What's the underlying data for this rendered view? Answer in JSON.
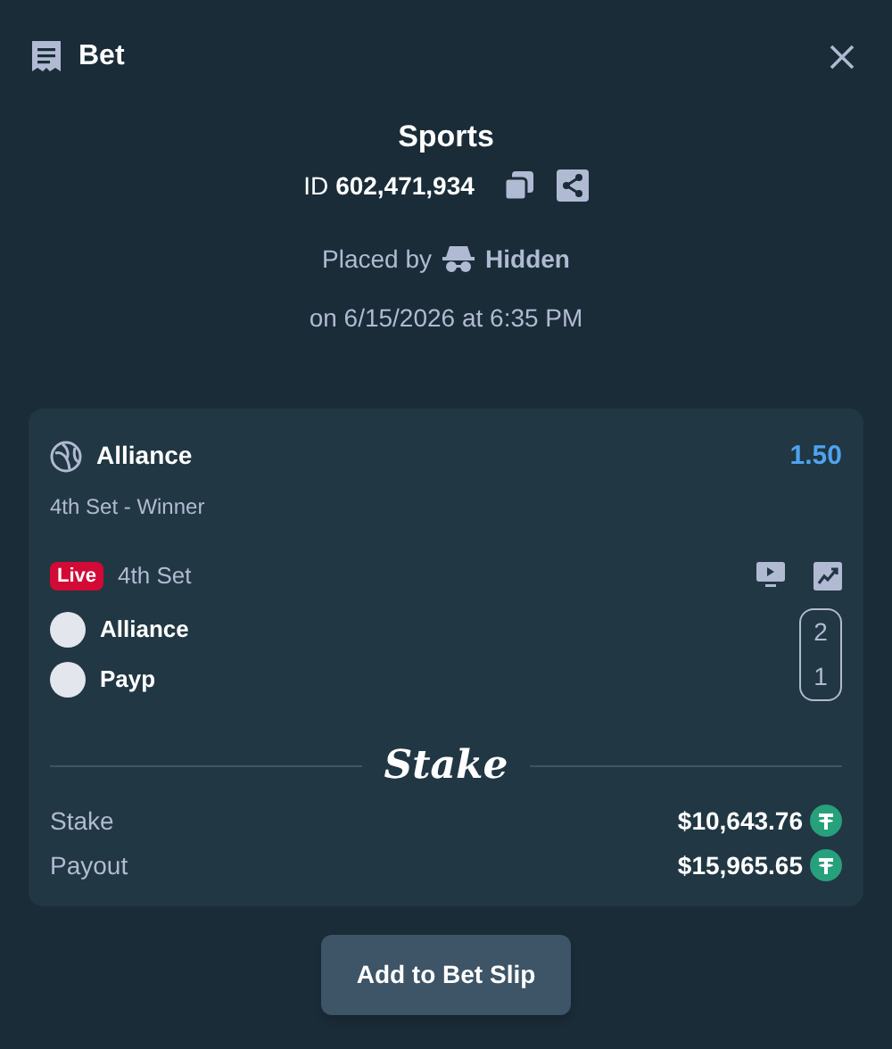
{
  "header": {
    "title": "Bet"
  },
  "summary": {
    "category": "Sports",
    "id_label": "ID",
    "id_value": "602,471,934",
    "placed_by_label": "Placed by",
    "placed_by_user": "Hidden",
    "placed_on": "on 6/15/2026 at 6:35 PM"
  },
  "selection": {
    "team": "Alliance",
    "odds": "1.50",
    "market": "4th Set - Winner",
    "live_badge": "Live",
    "period": "4th Set"
  },
  "scoreboard": [
    {
      "team": "Alliance",
      "score": "2"
    },
    {
      "team": "Payp",
      "score": "1"
    }
  ],
  "brand": "Stake",
  "amounts": [
    {
      "label": "Stake",
      "value": "$10,643.76"
    },
    {
      "label": "Payout",
      "value": "$15,965.65"
    }
  ],
  "action_button": "Add to Bet Slip"
}
